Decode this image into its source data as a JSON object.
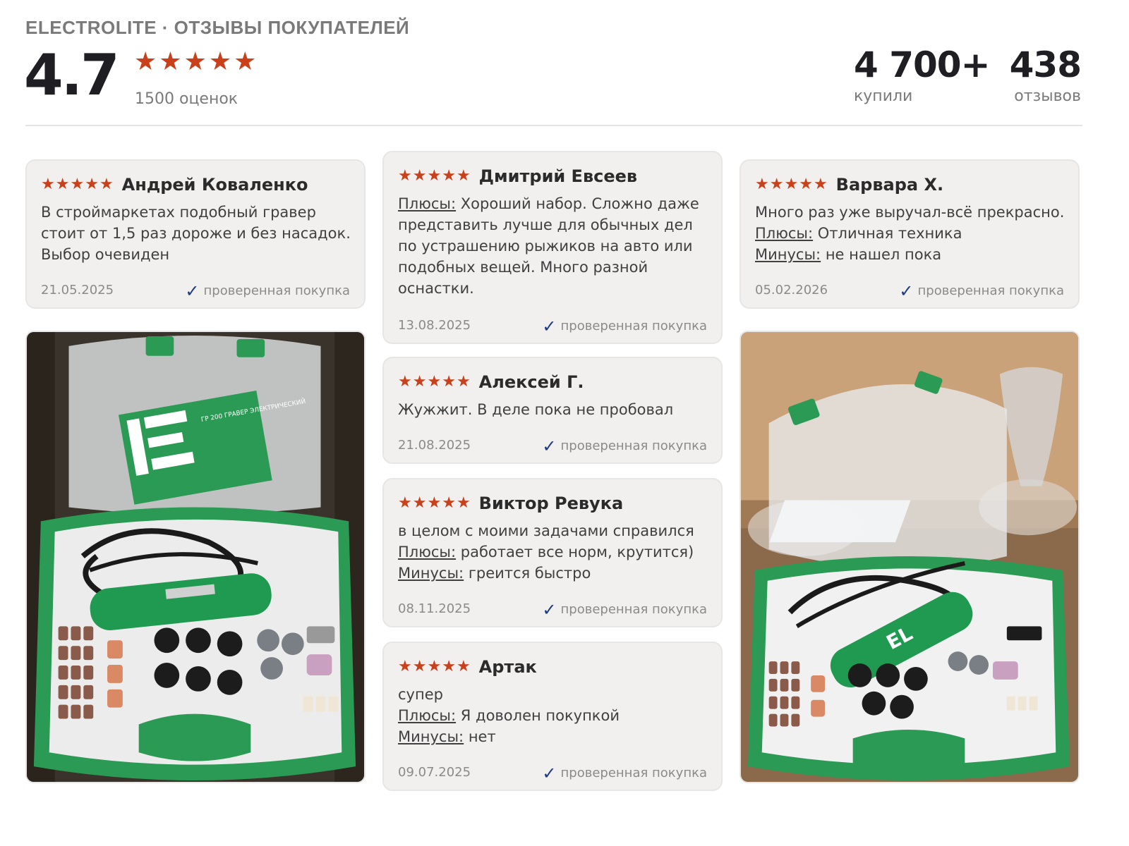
{
  "header": {
    "brand": "ELECTROLITE · ОТЗЫВЫ ПОКУПАТЕЛЕЙ",
    "rating": "4.7",
    "rating_count": "1500 оценок",
    "bought_value": "4 700+",
    "bought_label": "купили",
    "reviews_value": "438",
    "reviews_label": "отзывов"
  },
  "colors": {
    "star": "#c9401b",
    "check": "#1e3a80",
    "accent_green": "#2a9a55"
  },
  "verified_label": "проверенная покупка",
  "labels": {
    "plus": "Плюсы:",
    "minus": "Минусы:"
  },
  "reviews": [
    {
      "author": "Андрей Коваленко",
      "text": "В строймаркетах подобный гравер стоит от 1,5 раз дороже и без насадок. Выбор очевиден",
      "date": "21.05.2025"
    },
    {
      "author": "Дмитрий Евсеев",
      "plus": "Хороший набор. Сложно даже представить лучше для обычных дел по устрашению рыжиков на авто или подобных вещей. Много разной оснастки.",
      "date": "13.08.2025"
    },
    {
      "author": "Варвара Х.",
      "text": "Много раз уже выручал-всё прекрасно.",
      "plus": "Отличная техника",
      "minus": "не нашел пока",
      "date": "05.02.2026"
    },
    {
      "author": "Алексей Г.",
      "text": "Жужжит. В деле пока не пробовал",
      "date": "21.08.2025"
    },
    {
      "author": "Виктор Ревука",
      "text": "в целом с моими задачами справился",
      "plus": "работает все норм, крутится)",
      "minus": "греится быстро",
      "date": "08.11.2025"
    },
    {
      "author": "Артак",
      "text": "супер",
      "plus": "Я доволен покупкой",
      "minus": "нет",
      "date": "09.07.2025"
    }
  ],
  "photos": {
    "left_manual_text": "ГР 200 ГРАВЕР ЭЛЕКТРИЧЕСКИЙ",
    "left_logo": "EL",
    "right_logo": "EL"
  }
}
